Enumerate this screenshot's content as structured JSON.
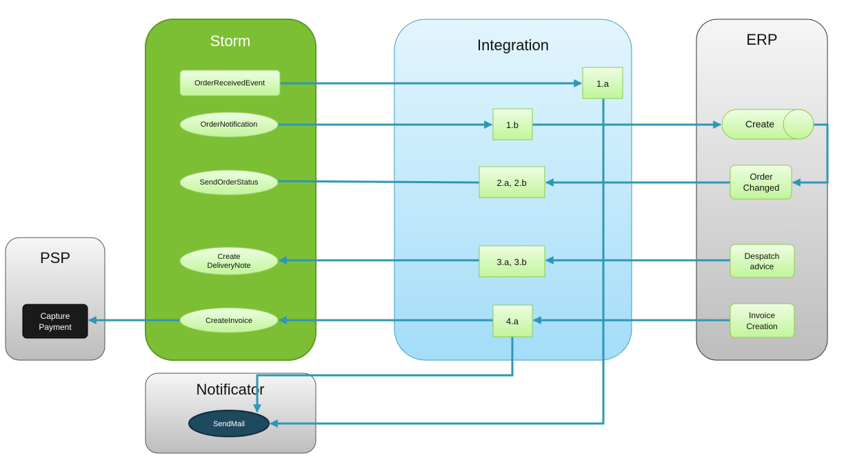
{
  "colors": {
    "arrow": "#2e97b5",
    "storm": "#7cbf34",
    "integration": "#bfe8fb",
    "erp": "#d9d9d9",
    "node": "#d8f7b8",
    "capture": "#1a1a1a",
    "sendmail": "#1d4a5c"
  },
  "containers": {
    "storm": "Storm",
    "integration": "Integration",
    "erp": "ERP",
    "psp": "PSP",
    "notificator": "Notificator"
  },
  "storm_nodes": {
    "order_received_event": "OrderReceivedEvent",
    "order_notification": "OrderNotification",
    "send_order_status": "SendOrderStatus",
    "create_delivery_note": [
      "Create",
      "DeliveryNote"
    ],
    "create_invoice": "CreateInvoice"
  },
  "integration_steps": {
    "s1a": "1.a",
    "s1b": "1.b",
    "s2": "2.a, 2.b",
    "s3": "3.a, 3.b",
    "s4": "4.a"
  },
  "erp_nodes": {
    "create": "Create",
    "order_changed": [
      "Order",
      "Changed"
    ],
    "despatch_advice": [
      "Despatch",
      "advice"
    ],
    "invoice_creation": [
      "Invoice",
      "Creation"
    ]
  },
  "psp_nodes": {
    "capture_payment": [
      "Capture",
      "Payment"
    ]
  },
  "notificator_nodes": {
    "send_mail": "SendMail"
  }
}
